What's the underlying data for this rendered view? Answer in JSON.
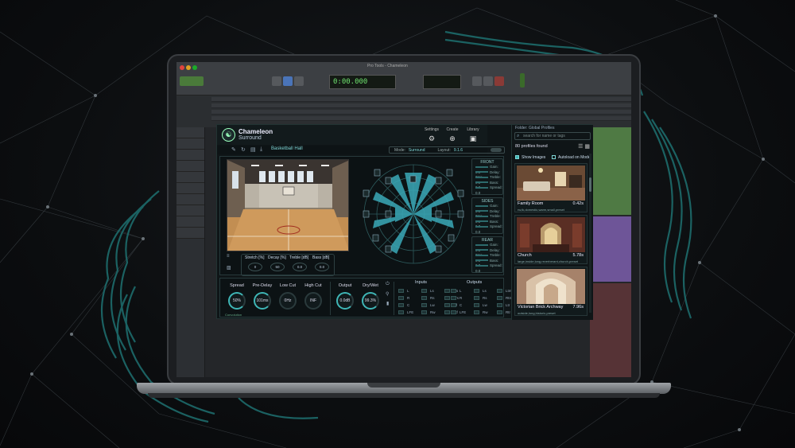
{
  "plugin": {
    "brand_line1": "Chameleon",
    "brand_line2": "Surround",
    "header_buttons": [
      {
        "label": "Settings",
        "icon": "gear-icon",
        "glyph": "⚙"
      },
      {
        "label": "Create",
        "icon": "magnifier-plus-icon",
        "glyph": "⊕"
      },
      {
        "label": "Library",
        "icon": "library-icon",
        "glyph": "▣"
      }
    ],
    "preset_name": "Basketball Hall",
    "mode_label": "Mode:",
    "mode_value": "Surround",
    "layout_label": "Layout:",
    "layout_value": "9.1.6"
  },
  "eq": {
    "labels": [
      "Stretch [%]",
      "Decay [%]",
      "Treble [dB]",
      "Bass [dB]"
    ],
    "values": [
      "0",
      "50",
      "0.0",
      "0.0"
    ]
  },
  "speaker_groups": [
    {
      "title": "FRONT",
      "lines": [
        "Gain: 0.0",
        "Delay: 0ms",
        "Treble: 0.0",
        "Bass: 0.0",
        "Spread: 0.0"
      ]
    },
    {
      "title": "SIDES",
      "lines": [
        "Gain: 0.0",
        "Delay: 0ms",
        "Treble: 0.0",
        "Bass: 0.0",
        "Spread: 0.0"
      ]
    },
    {
      "title": "REAR",
      "lines": [
        "Gain: 0.0",
        "Delay: 0ms",
        "Treble: 0.0",
        "Bass: 0.0",
        "Spread: 0.0"
      ]
    }
  ],
  "knobs": [
    {
      "label": "Spread",
      "value": "50%"
    },
    {
      "label": "Pre-Delay",
      "value": "101ms"
    },
    {
      "label": "Low Cut",
      "value": "0Hz"
    },
    {
      "label": "High Cut",
      "value": "INF"
    },
    {
      "label": "Output",
      "value": "0.0dB"
    },
    {
      "label": "Dry/Wet",
      "value": "99.3%"
    }
  ],
  "bottom_status": "Convolution",
  "io": {
    "inputs_title": "Inputs",
    "outputs_title": "Outputs",
    "inputs_rows": [
      [
        "L",
        "Ls",
        "Lrs",
        "Ltm"
      ],
      [
        "R",
        "Rs",
        "Rrs",
        "Rtm"
      ],
      [
        "C",
        "Lw",
        "Ltf",
        "Ltr"
      ],
      [
        "LFE",
        "Rw",
        "Rtf",
        "Rtr"
      ]
    ],
    "outputs_rows": [
      [
        "L",
        "Ls",
        "Lrs",
        "Ltm"
      ],
      [
        "R",
        "Rs",
        "Rrs",
        "Rtm"
      ],
      [
        "C",
        "Lw",
        "Ltf",
        "Ltr"
      ],
      [
        "LFE",
        "Rw",
        "Rtf",
        "Rtr"
      ]
    ]
  },
  "library": {
    "folder": "Folder: Global Profiles",
    "search_placeholder": "search for name or tags",
    "count": "80 profiles found",
    "show_images": "Show Images",
    "autoload": "Autoload on Mode",
    "cards": [
      {
        "name": "Family Room",
        "duration": "0.42s",
        "tags": "rw,tk,domestic,warm,small,preset"
      },
      {
        "name": "Church",
        "duration": "5.78s",
        "tags": "large,inside,long,reverberant,church,preset"
      },
      {
        "name": "Victorian Brick Archway",
        "duration": "7.96s",
        "tags": "outside,long,historic,preset"
      }
    ]
  },
  "daw": {
    "title": "Pro Tools - Chameleon",
    "counter": "0:00.000",
    "colors": {
      "green_clip": "#5a8a4a",
      "purple_clip": "#7a5aa0",
      "red_clip": "#6a3a3a",
      "accent": "#3fb6b6"
    }
  }
}
